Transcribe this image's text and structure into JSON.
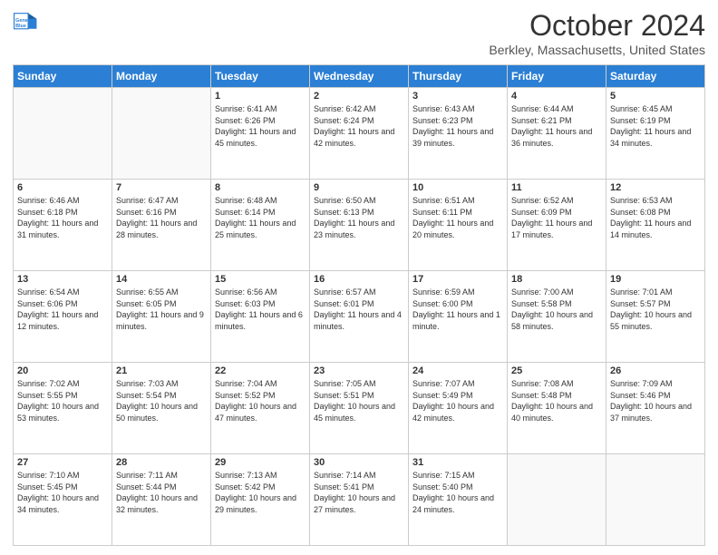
{
  "header": {
    "logo_line1": "General",
    "logo_line2": "Blue",
    "month_title": "October 2024",
    "location": "Berkley, Massachusetts, United States"
  },
  "weekdays": [
    "Sunday",
    "Monday",
    "Tuesday",
    "Wednesday",
    "Thursday",
    "Friday",
    "Saturday"
  ],
  "weeks": [
    [
      {
        "day": "",
        "info": ""
      },
      {
        "day": "",
        "info": ""
      },
      {
        "day": "1",
        "info": "Sunrise: 6:41 AM\nSunset: 6:26 PM\nDaylight: 11 hours and 45 minutes."
      },
      {
        "day": "2",
        "info": "Sunrise: 6:42 AM\nSunset: 6:24 PM\nDaylight: 11 hours and 42 minutes."
      },
      {
        "day": "3",
        "info": "Sunrise: 6:43 AM\nSunset: 6:23 PM\nDaylight: 11 hours and 39 minutes."
      },
      {
        "day": "4",
        "info": "Sunrise: 6:44 AM\nSunset: 6:21 PM\nDaylight: 11 hours and 36 minutes."
      },
      {
        "day": "5",
        "info": "Sunrise: 6:45 AM\nSunset: 6:19 PM\nDaylight: 11 hours and 34 minutes."
      }
    ],
    [
      {
        "day": "6",
        "info": "Sunrise: 6:46 AM\nSunset: 6:18 PM\nDaylight: 11 hours and 31 minutes."
      },
      {
        "day": "7",
        "info": "Sunrise: 6:47 AM\nSunset: 6:16 PM\nDaylight: 11 hours and 28 minutes."
      },
      {
        "day": "8",
        "info": "Sunrise: 6:48 AM\nSunset: 6:14 PM\nDaylight: 11 hours and 25 minutes."
      },
      {
        "day": "9",
        "info": "Sunrise: 6:50 AM\nSunset: 6:13 PM\nDaylight: 11 hours and 23 minutes."
      },
      {
        "day": "10",
        "info": "Sunrise: 6:51 AM\nSunset: 6:11 PM\nDaylight: 11 hours and 20 minutes."
      },
      {
        "day": "11",
        "info": "Sunrise: 6:52 AM\nSunset: 6:09 PM\nDaylight: 11 hours and 17 minutes."
      },
      {
        "day": "12",
        "info": "Sunrise: 6:53 AM\nSunset: 6:08 PM\nDaylight: 11 hours and 14 minutes."
      }
    ],
    [
      {
        "day": "13",
        "info": "Sunrise: 6:54 AM\nSunset: 6:06 PM\nDaylight: 11 hours and 12 minutes."
      },
      {
        "day": "14",
        "info": "Sunrise: 6:55 AM\nSunset: 6:05 PM\nDaylight: 11 hours and 9 minutes."
      },
      {
        "day": "15",
        "info": "Sunrise: 6:56 AM\nSunset: 6:03 PM\nDaylight: 11 hours and 6 minutes."
      },
      {
        "day": "16",
        "info": "Sunrise: 6:57 AM\nSunset: 6:01 PM\nDaylight: 11 hours and 4 minutes."
      },
      {
        "day": "17",
        "info": "Sunrise: 6:59 AM\nSunset: 6:00 PM\nDaylight: 11 hours and 1 minute."
      },
      {
        "day": "18",
        "info": "Sunrise: 7:00 AM\nSunset: 5:58 PM\nDaylight: 10 hours and 58 minutes."
      },
      {
        "day": "19",
        "info": "Sunrise: 7:01 AM\nSunset: 5:57 PM\nDaylight: 10 hours and 55 minutes."
      }
    ],
    [
      {
        "day": "20",
        "info": "Sunrise: 7:02 AM\nSunset: 5:55 PM\nDaylight: 10 hours and 53 minutes."
      },
      {
        "day": "21",
        "info": "Sunrise: 7:03 AM\nSunset: 5:54 PM\nDaylight: 10 hours and 50 minutes."
      },
      {
        "day": "22",
        "info": "Sunrise: 7:04 AM\nSunset: 5:52 PM\nDaylight: 10 hours and 47 minutes."
      },
      {
        "day": "23",
        "info": "Sunrise: 7:05 AM\nSunset: 5:51 PM\nDaylight: 10 hours and 45 minutes."
      },
      {
        "day": "24",
        "info": "Sunrise: 7:07 AM\nSunset: 5:49 PM\nDaylight: 10 hours and 42 minutes."
      },
      {
        "day": "25",
        "info": "Sunrise: 7:08 AM\nSunset: 5:48 PM\nDaylight: 10 hours and 40 minutes."
      },
      {
        "day": "26",
        "info": "Sunrise: 7:09 AM\nSunset: 5:46 PM\nDaylight: 10 hours and 37 minutes."
      }
    ],
    [
      {
        "day": "27",
        "info": "Sunrise: 7:10 AM\nSunset: 5:45 PM\nDaylight: 10 hours and 34 minutes."
      },
      {
        "day": "28",
        "info": "Sunrise: 7:11 AM\nSunset: 5:44 PM\nDaylight: 10 hours and 32 minutes."
      },
      {
        "day": "29",
        "info": "Sunrise: 7:13 AM\nSunset: 5:42 PM\nDaylight: 10 hours and 29 minutes."
      },
      {
        "day": "30",
        "info": "Sunrise: 7:14 AM\nSunset: 5:41 PM\nDaylight: 10 hours and 27 minutes."
      },
      {
        "day": "31",
        "info": "Sunrise: 7:15 AM\nSunset: 5:40 PM\nDaylight: 10 hours and 24 minutes."
      },
      {
        "day": "",
        "info": ""
      },
      {
        "day": "",
        "info": ""
      }
    ]
  ]
}
